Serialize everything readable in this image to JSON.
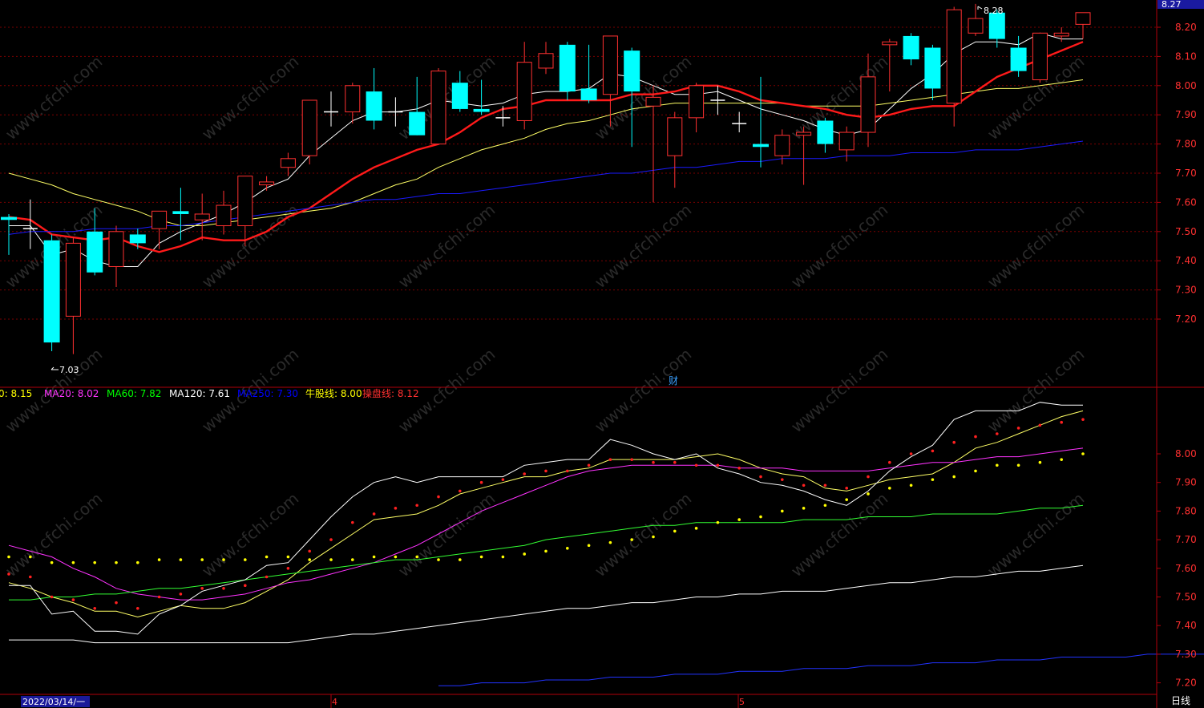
{
  "toolbar": {
    "current_price": "8.27",
    "period_label": "日线",
    "date_label": "2022/03/14/一",
    "month_labels": [
      "4",
      "5"
    ],
    "finance_marker": "财",
    "max_marker": "8.28",
    "min_marker": "7.03"
  },
  "watermark": "www.cfchi.com",
  "colors": {
    "background": "#000000",
    "up": "#ff3030",
    "down": "#00ffff",
    "axis": "#b0000a",
    "grid": "#7a0000",
    "ma5": "#ffffff",
    "ma10": "#ffff66",
    "ma_red": "#ff1a1a",
    "ma60": "#0000ff"
  },
  "legend": [
    {
      "label": "0: 8.15",
      "color": "#ffff00"
    },
    {
      "label": "MA20: 8.02",
      "color": "#ff33ff"
    },
    {
      "label": "MA60: 7.82",
      "color": "#00ff00"
    },
    {
      "label": "MA120: 7.61",
      "color": "#ffffff"
    },
    {
      "label": "MA250: 7.30",
      "color": "#0000ff"
    },
    {
      "label": "牛股线: 8.00",
      "color": "#ffff00"
    },
    {
      "label": "操盘线: 8.12",
      "color": "#ff3030"
    }
  ],
  "chart_data": [
    {
      "type": "candlestick",
      "ylim": [
        7.03,
        8.28
      ],
      "y_ticks": [
        "7.20",
        "7.30",
        "7.40",
        "7.50",
        "7.60",
        "7.70",
        "7.80",
        "7.90",
        "8.00",
        "8.10",
        "8.20"
      ],
      "candles": [
        {
          "o": 7.55,
          "c": 7.54,
          "h": 7.56,
          "l": 7.42
        },
        {
          "o": 7.51,
          "c": 7.51,
          "h": 7.61,
          "l": 7.44
        },
        {
          "o": 7.47,
          "c": 7.12,
          "h": 7.49,
          "l": 7.09
        },
        {
          "o": 7.21,
          "c": 7.46,
          "h": 7.48,
          "l": 7.08
        },
        {
          "o": 7.5,
          "c": 7.36,
          "h": 7.58,
          "l": 7.35
        },
        {
          "o": 7.38,
          "c": 7.5,
          "h": 7.52,
          "l": 7.31
        },
        {
          "o": 7.49,
          "c": 7.46,
          "h": 7.51,
          "l": 7.44
        },
        {
          "o": 7.51,
          "c": 7.57,
          "h": 7.57,
          "l": 7.44
        },
        {
          "o": 7.57,
          "c": 7.56,
          "h": 7.65,
          "l": 7.47
        },
        {
          "o": 7.54,
          "c": 7.56,
          "h": 7.63,
          "l": 7.47
        },
        {
          "o": 7.52,
          "c": 7.59,
          "h": 7.64,
          "l": 7.49
        },
        {
          "o": 7.52,
          "c": 7.69,
          "h": 7.69,
          "l": 7.45
        },
        {
          "o": 7.66,
          "c": 7.67,
          "h": 7.69,
          "l": 7.64
        },
        {
          "o": 7.72,
          "c": 7.75,
          "h": 7.77,
          "l": 7.69
        },
        {
          "o": 7.76,
          "c": 7.95,
          "h": 7.95,
          "l": 7.73
        },
        {
          "o": 7.91,
          "c": 7.91,
          "h": 7.98,
          "l": 7.86
        },
        {
          "o": 7.91,
          "c": 8.0,
          "h": 8.01,
          "l": 7.87
        },
        {
          "o": 7.98,
          "c": 7.88,
          "h": 8.06,
          "l": 7.85
        },
        {
          "o": 7.91,
          "c": 7.91,
          "h": 7.96,
          "l": 7.86
        },
        {
          "o": 7.91,
          "c": 7.83,
          "h": 8.03,
          "l": 7.83
        },
        {
          "o": 7.8,
          "c": 8.05,
          "h": 8.06,
          "l": 7.8
        },
        {
          "o": 8.01,
          "c": 7.92,
          "h": 8.05,
          "l": 7.91
        },
        {
          "o": 7.92,
          "c": 7.91,
          "h": 8.02,
          "l": 7.9
        },
        {
          "o": 7.89,
          "c": 7.89,
          "h": 7.93,
          "l": 7.86
        },
        {
          "o": 7.88,
          "c": 8.08,
          "h": 8.15,
          "l": 7.85
        },
        {
          "o": 8.06,
          "c": 8.11,
          "h": 8.15,
          "l": 8.04
        },
        {
          "o": 8.14,
          "c": 7.98,
          "h": 8.15,
          "l": 7.95
        },
        {
          "o": 7.99,
          "c": 7.95,
          "h": 8.14,
          "l": 7.94
        },
        {
          "o": 7.97,
          "c": 8.17,
          "h": 8.17,
          "l": 7.86
        },
        {
          "o": 8.12,
          "c": 7.98,
          "h": 8.13,
          "l": 7.79
        },
        {
          "o": 7.93,
          "c": 7.96,
          "h": 8.0,
          "l": 7.6
        },
        {
          "o": 7.76,
          "c": 7.89,
          "h": 7.91,
          "l": 7.65
        },
        {
          "o": 7.89,
          "c": 8.0,
          "h": 8.01,
          "l": 7.84
        },
        {
          "o": 7.95,
          "c": 7.95,
          "h": 8.0,
          "l": 7.9
        },
        {
          "o": 7.87,
          "c": 7.87,
          "h": 7.91,
          "l": 7.84
        },
        {
          "o": 7.8,
          "c": 7.79,
          "h": 8.03,
          "l": 7.72
        },
        {
          "o": 7.76,
          "c": 7.83,
          "h": 7.85,
          "l": 7.73
        },
        {
          "o": 7.83,
          "c": 7.84,
          "h": 7.86,
          "l": 7.66
        },
        {
          "o": 7.88,
          "c": 7.8,
          "h": 7.89,
          "l": 7.77
        },
        {
          "o": 7.78,
          "c": 7.84,
          "h": 7.86,
          "l": 7.74
        },
        {
          "o": 7.84,
          "c": 8.03,
          "h": 8.11,
          "l": 7.79
        },
        {
          "o": 8.14,
          "c": 8.15,
          "h": 8.16,
          "l": 7.98
        },
        {
          "o": 8.17,
          "c": 8.09,
          "h": 8.18,
          "l": 8.07
        },
        {
          "o": 8.13,
          "c": 7.99,
          "h": 8.14,
          "l": 7.95
        },
        {
          "o": 7.94,
          "c": 8.26,
          "h": 8.27,
          "l": 7.86
        },
        {
          "o": 8.18,
          "c": 8.23,
          "h": 8.28,
          "l": 8.17
        },
        {
          "o": 8.25,
          "c": 8.16,
          "h": 8.26,
          "l": 8.13
        },
        {
          "o": 8.13,
          "c": 8.05,
          "h": 8.17,
          "l": 8.03
        },
        {
          "o": 8.02,
          "c": 8.18,
          "h": 8.18,
          "l": 8.01
        },
        {
          "o": 8.17,
          "c": 8.18,
          "h": 8.2,
          "l": 8.15
        },
        {
          "o": 8.21,
          "c": 8.25,
          "h": 8.25,
          "l": 8.16
        }
      ],
      "lines": [
        {
          "color": "#ffffff",
          "width": 1,
          "values": [
            7.52,
            7.52,
            7.42,
            7.44,
            7.4,
            7.38,
            7.38,
            7.46,
            7.5,
            7.53,
            7.56,
            7.6,
            7.65,
            7.68,
            7.76,
            7.82,
            7.88,
            7.91,
            7.91,
            7.92,
            7.95,
            7.94,
            7.93,
            7.94,
            7.97,
            7.98,
            7.98,
            7.99,
            8.04,
            8.03,
            8.0,
            7.97,
            7.97,
            7.98,
            7.95,
            7.92,
            7.9,
            7.88,
            7.85,
            7.83,
            7.85,
            7.92,
            7.99,
            8.04,
            8.11,
            8.15,
            8.15,
            8.14,
            8.18,
            8.16,
            8.16
          ]
        },
        {
          "color": "#ffff66",
          "width": 1,
          "values": [
            7.7,
            7.68,
            7.66,
            7.63,
            7.61,
            7.59,
            7.57,
            7.54,
            7.52,
            7.52,
            7.53,
            7.54,
            7.55,
            7.56,
            7.57,
            7.58,
            7.6,
            7.63,
            7.66,
            7.68,
            7.72,
            7.75,
            7.78,
            7.8,
            7.82,
            7.85,
            7.87,
            7.88,
            7.9,
            7.92,
            7.93,
            7.94,
            7.94,
            7.94,
            7.94,
            7.94,
            7.94,
            7.93,
            7.93,
            7.93,
            7.93,
            7.94,
            7.95,
            7.96,
            7.97,
            7.98,
            7.99,
            7.99,
            8.0,
            8.01,
            8.02
          ]
        },
        {
          "color": "#ff1a1a",
          "width": 2.4,
          "values": [
            7.55,
            7.54,
            7.49,
            7.48,
            7.47,
            7.48,
            7.45,
            7.43,
            7.45,
            7.48,
            7.47,
            7.47,
            7.5,
            7.55,
            7.58,
            7.63,
            7.68,
            7.72,
            7.75,
            7.78,
            7.8,
            7.84,
            7.89,
            7.92,
            7.93,
            7.95,
            7.95,
            7.95,
            7.95,
            7.97,
            7.97,
            7.98,
            8.0,
            8.0,
            7.98,
            7.95,
            7.94,
            7.93,
            7.92,
            7.9,
            7.89,
            7.9,
            7.92,
            7.93,
            7.93,
            7.98,
            8.03,
            8.06,
            8.09,
            8.12,
            8.15
          ]
        },
        {
          "color": "#1a1aff",
          "width": 1,
          "values": [
            7.49,
            7.5,
            7.5,
            7.5,
            7.51,
            7.51,
            7.51,
            7.52,
            7.52,
            7.53,
            7.54,
            7.55,
            7.56,
            7.57,
            7.58,
            7.59,
            7.6,
            7.61,
            7.61,
            7.62,
            7.63,
            7.63,
            7.64,
            7.65,
            7.66,
            7.67,
            7.68,
            7.69,
            7.7,
            7.7,
            7.71,
            7.72,
            7.72,
            7.73,
            7.74,
            7.74,
            7.75,
            7.75,
            7.75,
            7.76,
            7.76,
            7.76,
            7.77,
            7.77,
            7.77,
            7.78,
            7.78,
            7.78,
            7.79,
            7.8,
            7.81
          ]
        }
      ]
    },
    {
      "type": "line",
      "ylim": [
        7.15,
        8.15
      ],
      "y_ticks": [
        "7.20",
        "7.30",
        "7.40",
        "7.50",
        "7.60",
        "7.70",
        "7.80",
        "7.90",
        "8.00"
      ],
      "series": [
        {
          "name": "MA10",
          "color": "#ffff66",
          "values": [
            7.55,
            7.53,
            7.5,
            7.48,
            7.45,
            7.45,
            7.43,
            7.45,
            7.47,
            7.46,
            7.46,
            7.48,
            7.52,
            7.56,
            7.62,
            7.67,
            7.72,
            7.77,
            7.78,
            7.79,
            7.82,
            7.86,
            7.88,
            7.9,
            7.92,
            7.92,
            7.94,
            7.95,
            7.98,
            7.98,
            7.98,
            7.98,
            7.99,
            8.0,
            7.98,
            7.95,
            7.93,
            7.92,
            7.88,
            7.87,
            7.89,
            7.91,
            7.92,
            7.93,
            7.97,
            8.02,
            8.04,
            8.07,
            8.1,
            8.13,
            8.15
          ]
        },
        {
          "name": "MA20",
          "color": "#ff33ff",
          "values": [
            7.68,
            7.66,
            7.64,
            7.6,
            7.57,
            7.53,
            7.51,
            7.5,
            7.49,
            7.49,
            7.5,
            7.51,
            7.53,
            7.55,
            7.56,
            7.58,
            7.6,
            7.62,
            7.65,
            7.68,
            7.72,
            7.76,
            7.8,
            7.83,
            7.86,
            7.89,
            7.92,
            7.94,
            7.95,
            7.96,
            7.96,
            7.96,
            7.96,
            7.96,
            7.95,
            7.95,
            7.95,
            7.94,
            7.94,
            7.94,
            7.94,
            7.95,
            7.96,
            7.97,
            7.97,
            7.98,
            7.99,
            7.99,
            8.0,
            8.01,
            8.02
          ]
        },
        {
          "name": "MA60",
          "color": "#33ff33",
          "values": [
            7.49,
            7.49,
            7.5,
            7.5,
            7.51,
            7.51,
            7.52,
            7.53,
            7.53,
            7.54,
            7.55,
            7.56,
            7.57,
            7.58,
            7.59,
            7.6,
            7.61,
            7.62,
            7.63,
            7.63,
            7.64,
            7.65,
            7.66,
            7.67,
            7.68,
            7.7,
            7.71,
            7.72,
            7.73,
            7.74,
            7.75,
            7.75,
            7.76,
            7.76,
            7.76,
            7.76,
            7.76,
            7.77,
            7.77,
            7.77,
            7.78,
            7.78,
            7.78,
            7.79,
            7.79,
            7.79,
            7.79,
            7.8,
            7.81,
            7.81,
            7.82
          ]
        },
        {
          "name": "MA120",
          "color": "#ffffff",
          "values": [
            7.35,
            7.35,
            7.35,
            7.35,
            7.34,
            7.34,
            7.34,
            7.34,
            7.34,
            7.34,
            7.34,
            7.34,
            7.34,
            7.34,
            7.35,
            7.36,
            7.37,
            7.37,
            7.38,
            7.39,
            7.4,
            7.41,
            7.42,
            7.43,
            7.44,
            7.45,
            7.46,
            7.46,
            7.47,
            7.48,
            7.48,
            7.49,
            7.5,
            7.5,
            7.51,
            7.51,
            7.52,
            7.52,
            7.52,
            7.53,
            7.54,
            7.55,
            7.55,
            7.56,
            7.57,
            7.57,
            7.58,
            7.59,
            7.59,
            7.6,
            7.61
          ]
        },
        {
          "name": "MA250",
          "color": "#2233ff",
          "start": 10,
          "values": [
            7.19,
            7.19,
            7.2,
            7.2,
            7.2,
            7.21,
            7.21,
            7.21,
            7.22,
            7.22,
            7.22,
            7.23,
            7.23,
            7.23,
            7.24,
            7.24,
            7.24,
            7.25,
            7.25,
            7.25,
            7.26,
            7.26,
            7.26,
            7.27,
            7.27,
            7.27,
            7.28,
            7.28,
            7.28,
            7.29,
            7.29,
            7.29,
            7.29,
            7.3,
            7.3,
            7.3,
            7.3,
            7.3,
            7.3,
            7.3,
            7.3
          ]
        },
        {
          "name": "MA5",
          "color": "#ffffff",
          "values": [
            7.54,
            7.54,
            7.44,
            7.45,
            7.38,
            7.38,
            7.37,
            7.44,
            7.47,
            7.52,
            7.54,
            7.56,
            7.61,
            7.62,
            7.7,
            7.78,
            7.85,
            7.9,
            7.92,
            7.9,
            7.92,
            7.92,
            7.92,
            7.92,
            7.96,
            7.97,
            7.98,
            7.98,
            8.05,
            8.03,
            8.0,
            7.98,
            8.0,
            7.95,
            7.93,
            7.9,
            7.89,
            7.87,
            7.84,
            7.82,
            7.87,
            7.94,
            7.99,
            8.03,
            8.12,
            8.15,
            8.15,
            8.15,
            8.18,
            8.17,
            8.17
          ]
        }
      ],
      "dot_series": [
        {
          "name": "牛股线",
          "color": "#ffff00",
          "values": [
            7.64,
            7.64,
            7.62,
            7.62,
            7.62,
            7.62,
            7.62,
            7.63,
            7.63,
            7.63,
            7.63,
            7.63,
            7.64,
            7.64,
            7.63,
            7.63,
            7.63,
            7.64,
            7.64,
            7.64,
            7.63,
            7.63,
            7.64,
            7.64,
            7.65,
            7.66,
            7.67,
            7.68,
            7.69,
            7.7,
            7.71,
            7.73,
            7.74,
            7.76,
            7.77,
            7.78,
            7.8,
            7.81,
            7.82,
            7.84,
            7.86,
            7.88,
            7.89,
            7.91,
            7.92,
            7.94,
            7.96,
            7.96,
            7.97,
            7.98,
            8.0
          ]
        },
        {
          "name": "操盘线",
          "color": "#ff2020",
          "values": [
            7.58,
            7.57,
            7.5,
            7.49,
            7.46,
            7.48,
            7.46,
            7.5,
            7.51,
            7.53,
            7.53,
            7.54,
            7.57,
            7.6,
            7.66,
            7.7,
            7.76,
            7.79,
            7.81,
            7.82,
            7.85,
            7.87,
            7.9,
            7.91,
            7.93,
            7.94,
            7.94,
            7.96,
            7.98,
            7.98,
            7.97,
            7.97,
            7.96,
            7.96,
            7.95,
            7.92,
            7.91,
            7.89,
            7.89,
            7.88,
            7.92,
            7.97,
            8.0,
            8.01,
            8.04,
            8.06,
            8.07,
            8.09,
            8.1,
            8.11,
            8.12
          ]
        }
      ]
    }
  ]
}
